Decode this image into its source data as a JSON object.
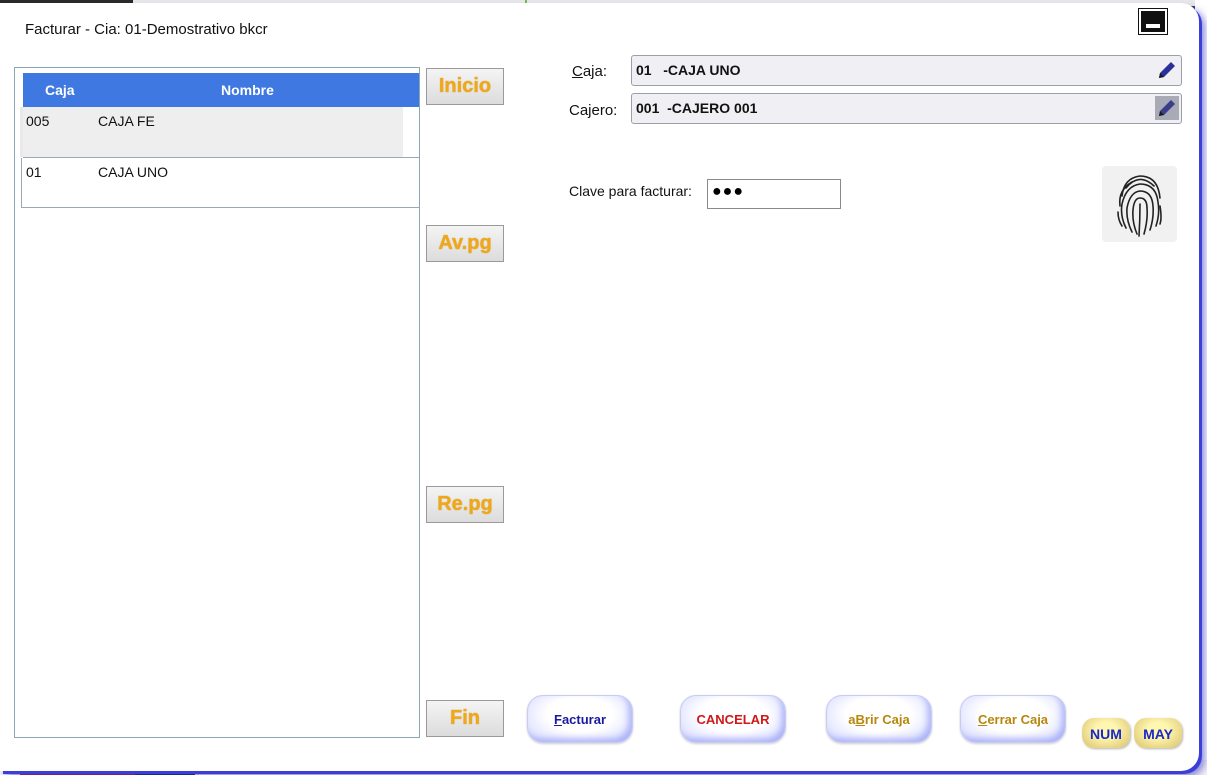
{
  "window": {
    "title": "Facturar - Cia: 01-Demostrativo bkcr"
  },
  "grid": {
    "headers": {
      "caja": "Caja",
      "nombre": "Nombre"
    },
    "rows": [
      {
        "caja": "005",
        "nombre": "CAJA FE"
      },
      {
        "caja": "01",
        "nombre": "CAJA UNO"
      }
    ]
  },
  "nav": {
    "inicio": "Inicio",
    "avpg": "Av.pg",
    "repg": "Re.pg",
    "fin": "Fin"
  },
  "form": {
    "caja_label_first": "C",
    "caja_label_rest": "aja:",
    "caja_value": "01   -CAJA UNO",
    "cajero_label": "Cajero:",
    "cajero_value": "001  -CAJERO 001",
    "clave_label": "Clave para facturar:",
    "clave_value": "●●●"
  },
  "actions": {
    "facturar_first": "F",
    "facturar_rest": "acturar",
    "cancelar": "CANCELAR",
    "abrir_pre": "a",
    "abrir_key": "B",
    "abrir_rest": "rir Caja",
    "cerrar_first": "C",
    "cerrar_rest": "errar Caja"
  },
  "indicators": {
    "num": "NUM",
    "may": "MAY"
  },
  "colors": {
    "grid_header": "#3e78e0",
    "nav_text": "#f0a818",
    "facturar": "#1a1aa0",
    "cancelar": "#d01818",
    "caja_buttons": "#b8860b",
    "indicator_text": "#1a28c8"
  },
  "icons": {
    "edit": "pencil-icon",
    "fingerprint": "fingerprint-icon",
    "minimize": "minimize-icon"
  }
}
